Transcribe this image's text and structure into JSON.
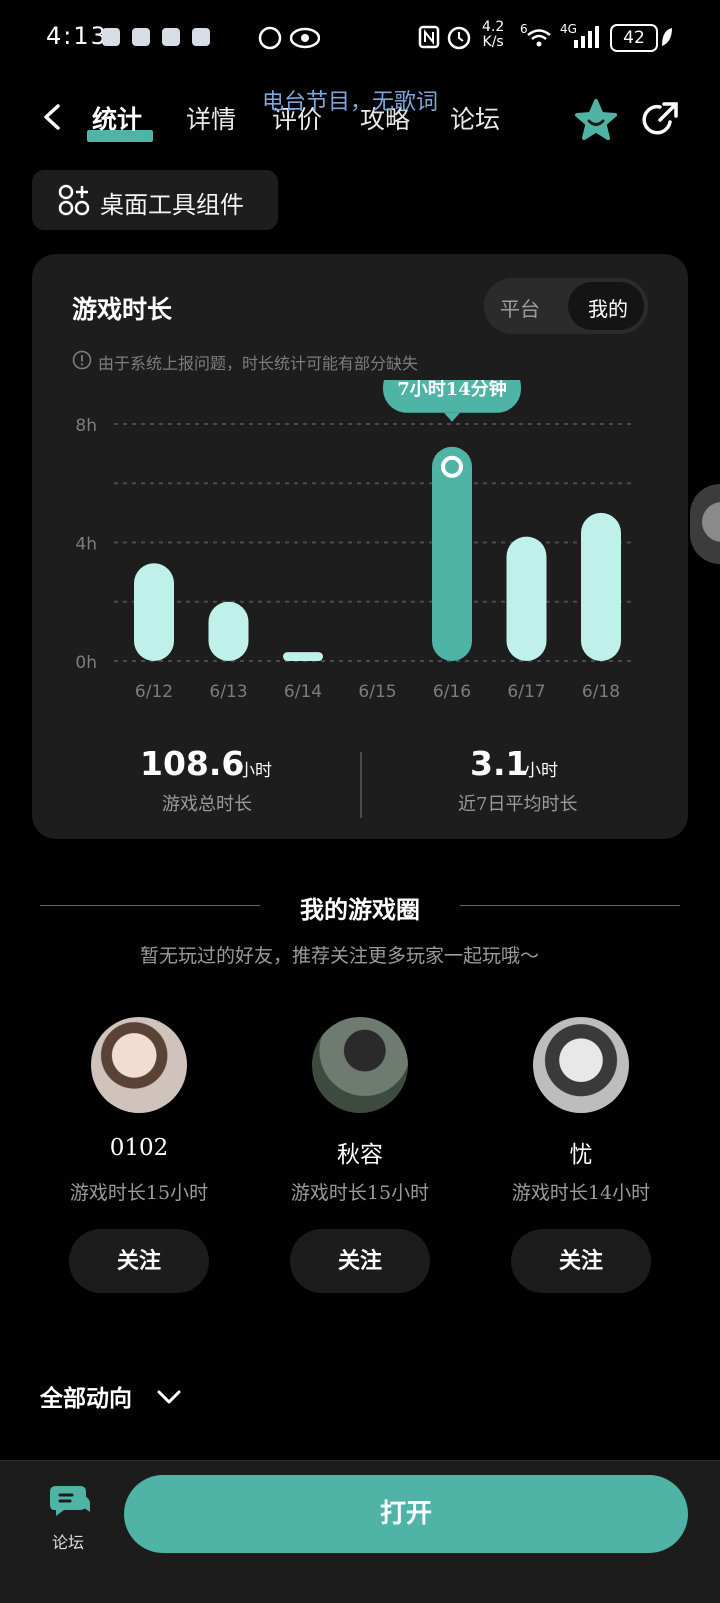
{
  "status_bar": {
    "time": "4:13",
    "net_speed": "4.2\nK/s",
    "net_speed_value": "4.2",
    "net_speed_unit": "K/s",
    "signal_badge": "6",
    "network": "4G",
    "battery": "42"
  },
  "nav": {
    "tabs": [
      "统计",
      "详情",
      "评价",
      "攻略",
      "论坛"
    ],
    "active_tab": "统计",
    "overlay_text": "电台节目，无歌词"
  },
  "widget_button": {
    "label": "桌面工具组件"
  },
  "playtime_card": {
    "title": "游戏时长",
    "toggle": {
      "options": [
        "平台",
        "我的"
      ],
      "selected": "我的"
    },
    "notice": "由于系统上报问题，时长统计可能有部分缺失",
    "tooltip": "7小时14分钟",
    "stats": {
      "total_value": "108.6",
      "total_unit": "小时",
      "total_label": "游戏总时长",
      "avg_value": "3.1",
      "avg_unit": "小时",
      "avg_label": "近7日平均时长"
    }
  },
  "chart_data": {
    "type": "bar",
    "categories": [
      "6/12",
      "6/13",
      "6/14",
      "6/15",
      "6/16",
      "6/17",
      "6/18"
    ],
    "values": [
      3.3,
      2.0,
      0.3,
      0,
      7.23,
      4.2,
      5.0
    ],
    "ylim": [
      0,
      8
    ],
    "yticks": [
      "0h",
      "4h",
      "8h"
    ],
    "highlight_index": 4,
    "colors": {
      "bar": "#bff0ea",
      "highlight": "#4fb3a6"
    },
    "grid": true
  },
  "game_circle": {
    "title": "我的游戏圈",
    "hint": "暂无玩过的好友，推荐关注更多玩家一起玩哦～",
    "players": [
      {
        "name": "0102",
        "duration": "游戏时长15小时",
        "follow": "关注"
      },
      {
        "name": "秋容",
        "duration": "游戏时长15小时",
        "follow": "关注"
      },
      {
        "name": "忧",
        "duration": "游戏时长14小时",
        "follow": "关注"
      }
    ]
  },
  "feed": {
    "label": "全部动向"
  },
  "bottom_bar": {
    "forum_label": "论坛",
    "open_button": "打开"
  },
  "colors": {
    "accent": "#4fb3a6",
    "background": "#000000",
    "card": "#1d1d1d"
  }
}
